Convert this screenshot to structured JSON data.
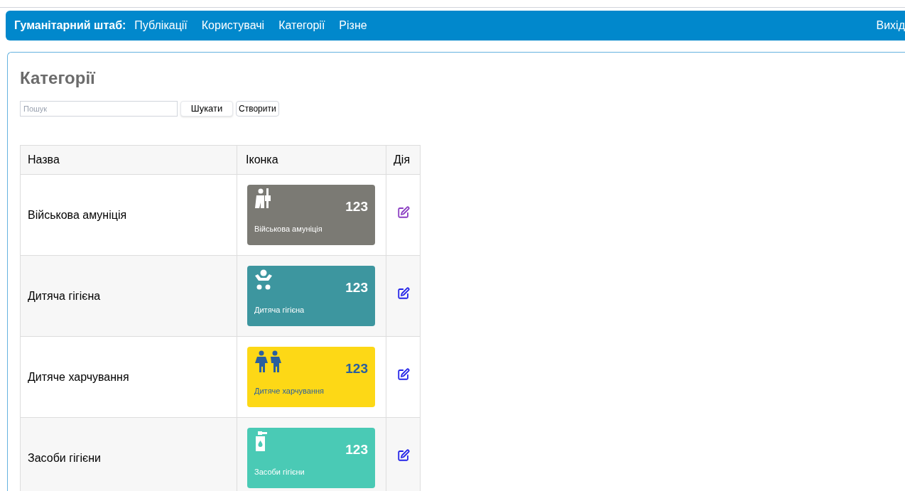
{
  "navbar": {
    "brand": "Гуманітарний штаб:",
    "links": [
      "Публікації",
      "Користувачі",
      "Категорії",
      "Різне"
    ],
    "logout": "Вихід"
  },
  "page": {
    "title": "Категорії",
    "search": {
      "placeholder": "Пошук"
    },
    "buttons": [
      "Шукати",
      "Створити"
    ]
  },
  "table": {
    "columns": [
      "Назва",
      "Іконка",
      "Дія"
    ],
    "rows": [
      {
        "name": "Військова амуніція",
        "tile": {
          "kind": "soldier",
          "color": "#7b7a74",
          "light_text": true,
          "count": "123",
          "label": "Військова амуніція"
        },
        "edit_visited": true
      },
      {
        "name": "Дитяча гігієна",
        "tile": {
          "kind": "baby",
          "color": "#3d969f",
          "light_text": true,
          "count": "123",
          "label": "Дитяча гігієна"
        },
        "edit_visited": false
      },
      {
        "name": "Дитяче харчування",
        "tile": {
          "kind": "children",
          "color": "#fdd816",
          "light_text": false,
          "count": "123",
          "label": "Дитяче харчування"
        },
        "edit_visited": false
      },
      {
        "name": "Засоби гігієни",
        "tile": {
          "kind": "soap",
          "color": "#4acab5",
          "light_text": true,
          "count": "123",
          "label": "Засоби гігієни"
        },
        "edit_visited": false
      }
    ]
  }
}
